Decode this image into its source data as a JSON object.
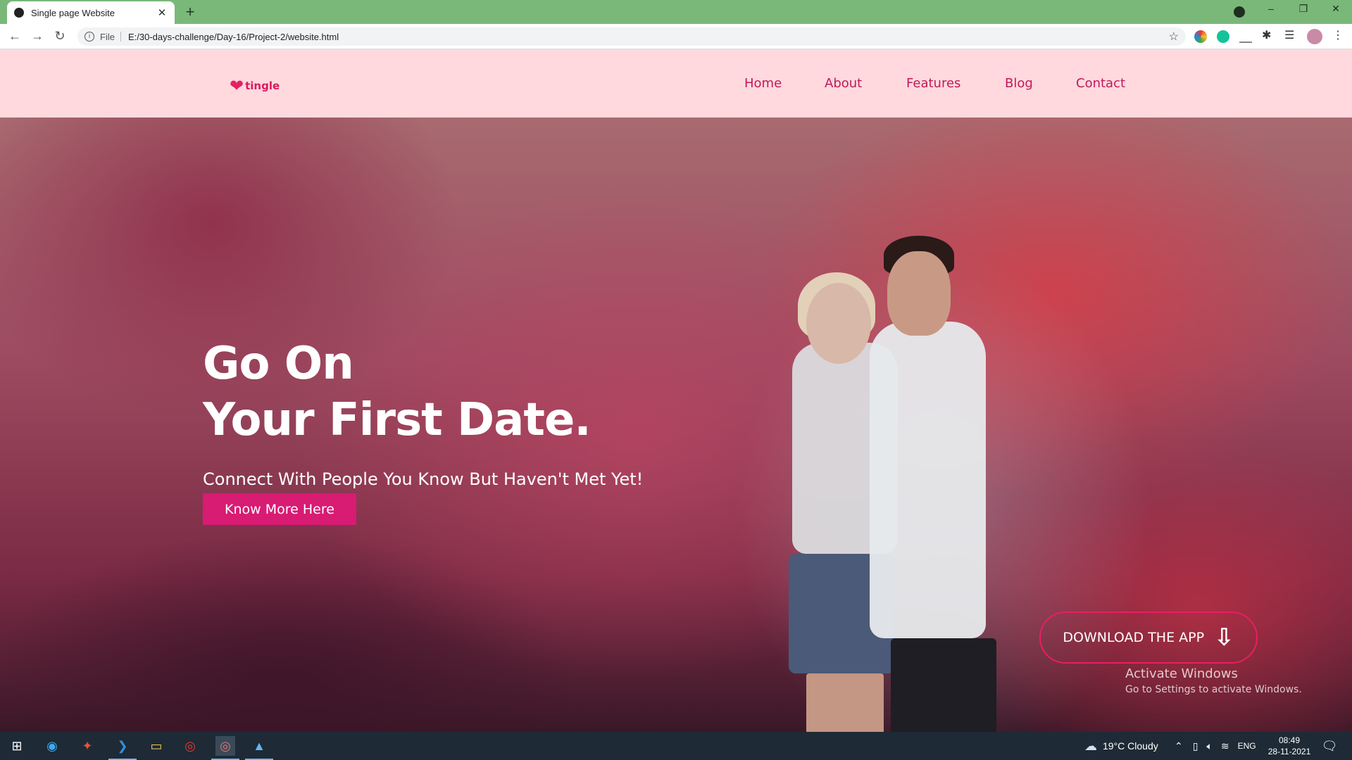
{
  "browser": {
    "tab_title": "Single page Website",
    "new_tab": "+",
    "url_scheme": "File",
    "url": "E:/30-days-challenge/Day-16/Project-2/website.html",
    "window": {
      "minimize": "–",
      "restore": "❐",
      "close": "✕"
    }
  },
  "site": {
    "logo_text": "tingle",
    "nav": [
      "Home",
      "About",
      "Features",
      "Blog",
      "Contact"
    ],
    "hero": {
      "title_line1": "Go On",
      "title_line2": "Your First Date.",
      "subtitle": "Connect With People You Know But Haven't Met Yet!",
      "cta": "Know More Here",
      "download": "DOWNLOAD THE APP"
    },
    "watermark": {
      "line1": "Activate Windows",
      "line2": "Go to Settings to activate Windows."
    }
  },
  "taskbar": {
    "weather": "19°C  Cloudy",
    "lang": "ENG",
    "time": "08:49",
    "date": "28-11-2021"
  },
  "colors": {
    "accent": "#d81b73",
    "header_bg": "#ffd9de",
    "tabbar_bg": "#7ab87a"
  }
}
